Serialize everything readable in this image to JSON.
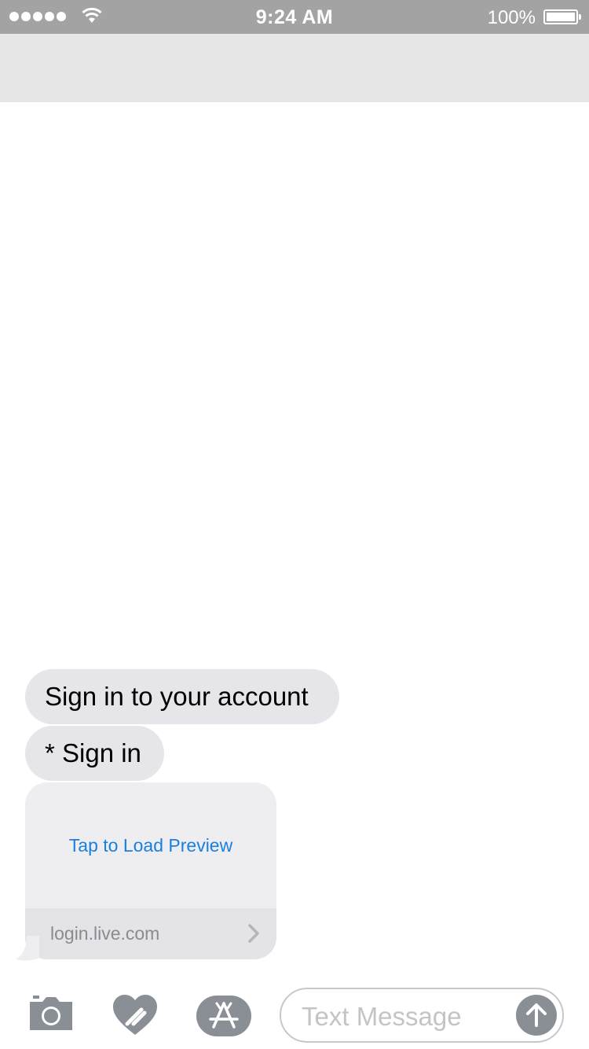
{
  "status_bar": {
    "time": "9:24 AM",
    "battery_percent": "100%",
    "battery_level": 1.0,
    "signal_bars": 5
  },
  "messages": [
    {
      "text": "Sign in to your account"
    },
    {
      "text": "* Sign in"
    }
  ],
  "link_preview": {
    "action_label": "Tap to Load Preview",
    "domain": "login.live.com",
    "chevron_icon": "chevron-right-icon"
  },
  "toolbar": {
    "icons": [
      "camera-icon",
      "digital-touch-heart-icon",
      "app-store-icon",
      "send-arrow-icon"
    ],
    "text_field_placeholder": "Text Message"
  },
  "colors": {
    "status_bar_bg": "#a3a3a3",
    "nav_bar_bg": "#e6e6e6",
    "received_bubble": "#e5e5ea",
    "link_blue": "#1a7fe0",
    "icon_gray": "#8a8e95"
  }
}
